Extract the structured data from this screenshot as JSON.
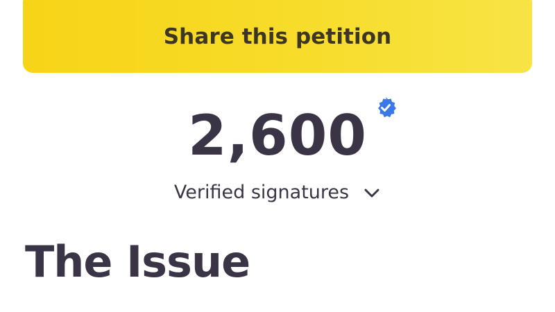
{
  "share": {
    "label": "Share this petition"
  },
  "signatures": {
    "count": "2,600",
    "label": "Verified signatures"
  },
  "issue": {
    "heading": "The Issue"
  },
  "icons": {
    "verified": "verified-badge-icon",
    "expand": "chevron-down-icon"
  },
  "colors": {
    "share_button": "#f7dc2a",
    "text": "#3a3446",
    "verified_badge": "#3b78e7"
  }
}
